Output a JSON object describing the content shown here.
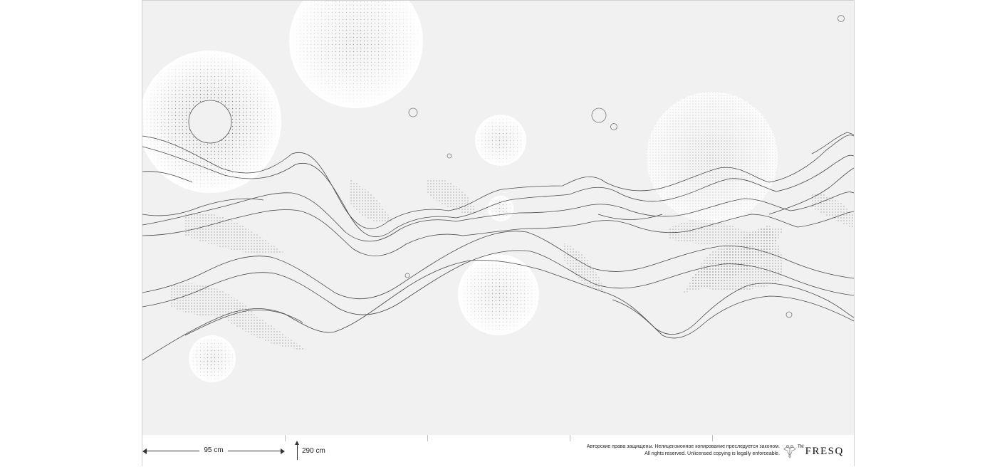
{
  "dimensions": {
    "width_label": "95 cm",
    "height_label": "290 cm"
  },
  "copyright": {
    "line_ru": "Авторские права защищены. Нелицензионное копирование преследуется законом.",
    "line_en": "All rights reserved. Unlicensed copying is legally enforceable."
  },
  "brand": {
    "trademark": "TM",
    "name": "FRESQ",
    "emblem_icon": "double-headed-eagle-icon"
  },
  "colors": {
    "mural_background": "#f1f1f1",
    "line_art": "#4a4a4a",
    "stipple": "#333333"
  }
}
